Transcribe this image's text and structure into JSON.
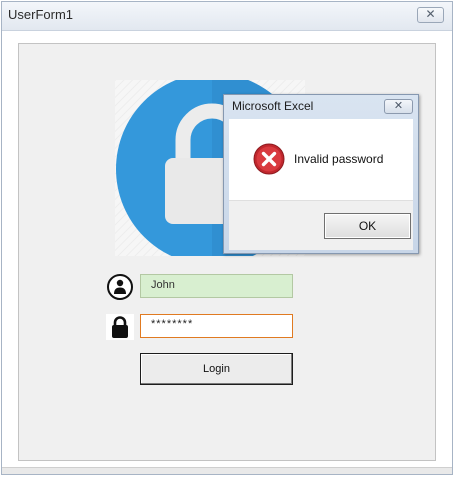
{
  "window": {
    "title": "UserForm1",
    "close_glyph": "✕"
  },
  "form": {
    "username_value": "John",
    "password_value": "********",
    "login_label": "Login",
    "icons": {
      "user": "user-circle-icon",
      "lock": "lock-icon",
      "hero": "padlock-image"
    }
  },
  "dialog": {
    "title": "Microsoft Excel",
    "close_glyph": "✕",
    "message": "Invalid password",
    "ok_label": "OK",
    "icon": "error-icon"
  },
  "colors": {
    "lock_blue": "#3498db",
    "lock_dark_blue": "#2a7fc0",
    "username_bg": "#d8efd0",
    "password_border": "#e07a21",
    "error_red": "#c0272d"
  }
}
